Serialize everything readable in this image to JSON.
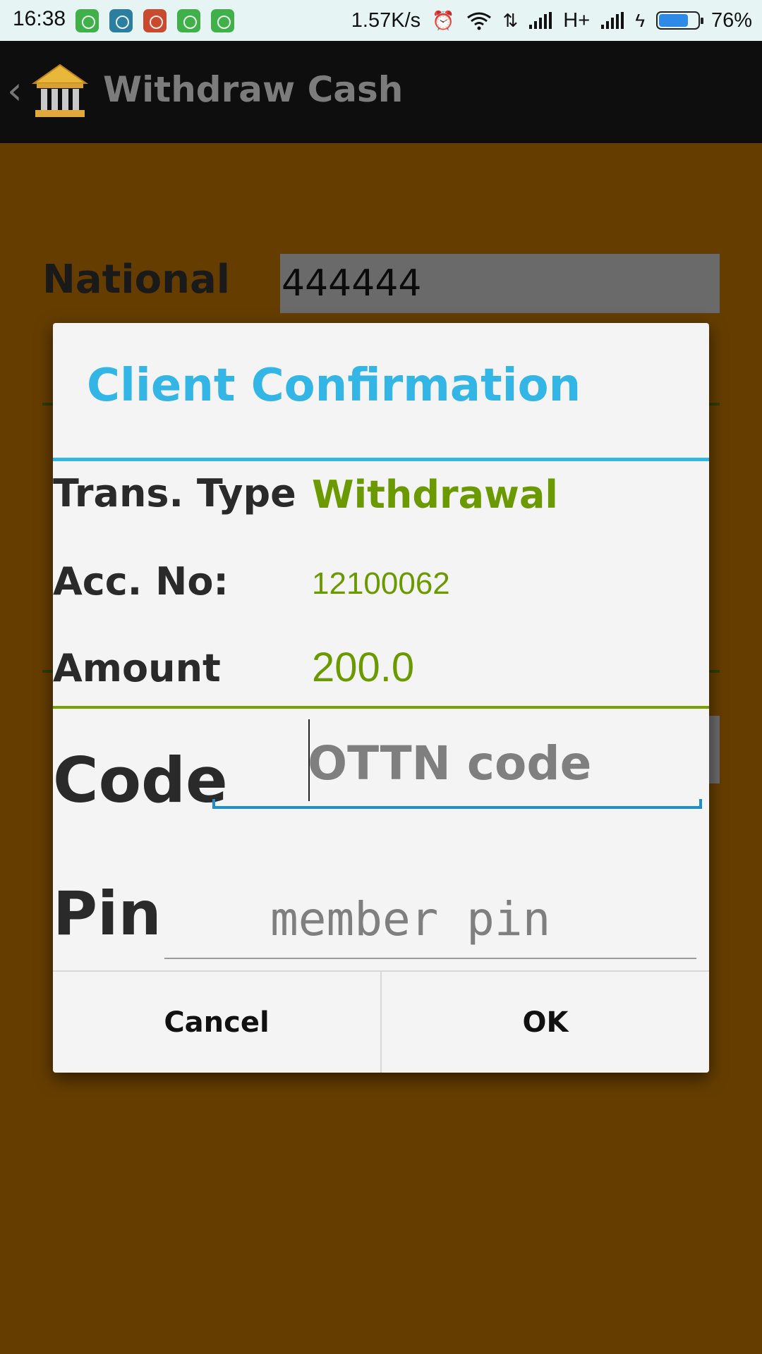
{
  "status_bar": {
    "time": "16:38",
    "speed": "1.57K/s",
    "network_type": "H+",
    "battery_percent": "76%",
    "battery_level": 0.76,
    "icons": [
      "alarm-icon",
      "wifi-icon",
      "data-arrows-icon",
      "signal-icon",
      "charging-icon"
    ]
  },
  "app_bar": {
    "title": "Withdraw Cash",
    "back_icon": "‹"
  },
  "background_form": {
    "national_label": "National",
    "national_value": "444444"
  },
  "dialog": {
    "title": "Client Confirmation",
    "rows": [
      {
        "label": "Trans. Type",
        "value": "Withdrawal"
      },
      {
        "label": "Acc. No:",
        "value": "12100062"
      },
      {
        "label": "Amount",
        "value": "200.0"
      }
    ],
    "code_label": "Code",
    "code_placeholder": "OTTN code",
    "pin_label": "Pin",
    "pin_placeholder": "member pin",
    "cancel_label": "Cancel",
    "ok_label": "OK"
  },
  "colors": {
    "page_background": "#653d00",
    "accent_blue": "#33b5e5",
    "value_green": "#6b9a00",
    "action_bar": "#0e0e0e"
  }
}
